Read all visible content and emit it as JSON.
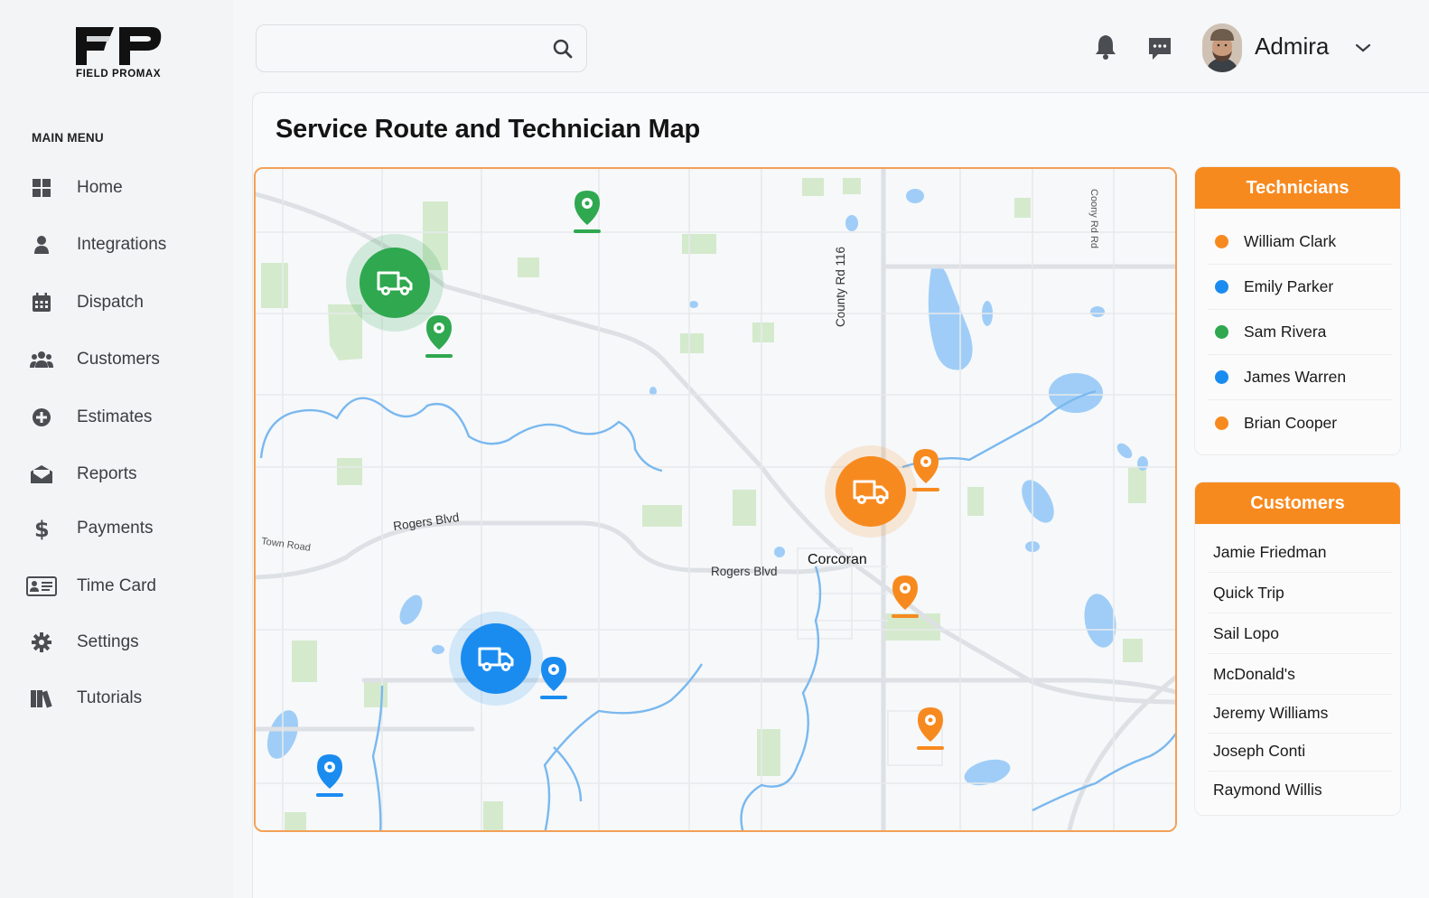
{
  "app": {
    "logo_text": "FIELD PROMAX",
    "logo_mark": "FP"
  },
  "sidebar": {
    "title": "MAIN MENU",
    "items": [
      {
        "label": "Home",
        "icon": "grid-icon"
      },
      {
        "label": "Integrations",
        "icon": "user-icon"
      },
      {
        "label": "Dispatch",
        "icon": "calendar-icon"
      },
      {
        "label": "Customers",
        "icon": "users-icon"
      },
      {
        "label": "Estimates",
        "icon": "plus-circle-icon"
      },
      {
        "label": "Reports",
        "icon": "envelope-icon"
      },
      {
        "label": "Payments",
        "icon": "dollar-icon"
      },
      {
        "label": "Time Card",
        "icon": "id-card-icon"
      },
      {
        "label": "Settings",
        "icon": "gear-icon"
      },
      {
        "label": "Tutorials",
        "icon": "books-icon"
      }
    ]
  },
  "header": {
    "search_placeholder": "",
    "search_value": "",
    "user_name": "Admira"
  },
  "page": {
    "title": "Service Route and Technician Map"
  },
  "map": {
    "labels": {
      "town": "Corcoran",
      "rogers_blvd_1": "Rogers Blvd",
      "rogers_blvd_2": "Rogers Blvd",
      "county_rd_116": "County Rd 116",
      "county_rd_top": "Coony Rd Rd",
      "small_road": "Town Road"
    },
    "colors": {
      "green": "#2fa84f",
      "blue": "#1a8cf0",
      "orange": "#f78a1f"
    }
  },
  "technicians": {
    "title": "Technicians",
    "items": [
      {
        "name": "William Clark",
        "color": "#f78a1f"
      },
      {
        "name": "Emily Parker",
        "color": "#1a8cf0"
      },
      {
        "name": "Sam Rivera",
        "color": "#2fa84f"
      },
      {
        "name": "James Warren",
        "color": "#1a8cf0"
      },
      {
        "name": "Brian Cooper",
        "color": "#f78a1f"
      }
    ]
  },
  "customers": {
    "title": "Customers",
    "items": [
      "Jamie Friedman",
      "Quick Trip",
      "Sail Lopo",
      "McDonald's",
      "Jeremy Williams",
      "Joseph Conti",
      "Raymond Willis"
    ]
  }
}
